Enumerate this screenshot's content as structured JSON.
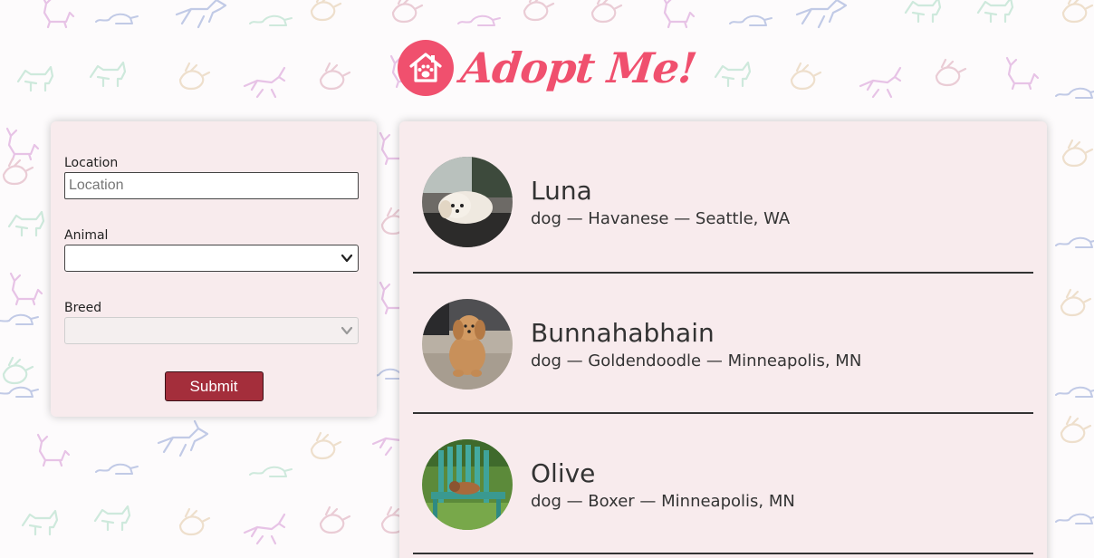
{
  "header": {
    "logo_text": "Adopt Me!",
    "logo_icon": "house-paw-icon",
    "brand_color": "#f0506e"
  },
  "search_form": {
    "location": {
      "label": "Location",
      "placeholder": "Location",
      "value": ""
    },
    "animal": {
      "label": "Animal",
      "selected": ""
    },
    "breed": {
      "label": "Breed",
      "selected": "",
      "disabled": true
    },
    "submit_label": "Submit",
    "submit_color": "#a42e3b"
  },
  "pets": [
    {
      "name": "Luna",
      "description": "dog — Havanese — Seattle, WA"
    },
    {
      "name": "Bunnahabhain",
      "description": "dog — Goldendoodle — Minneapolis, MN"
    },
    {
      "name": "Olive",
      "description": "dog — Boxer — Minneapolis, MN"
    }
  ],
  "panel_color": "#f8ebed"
}
